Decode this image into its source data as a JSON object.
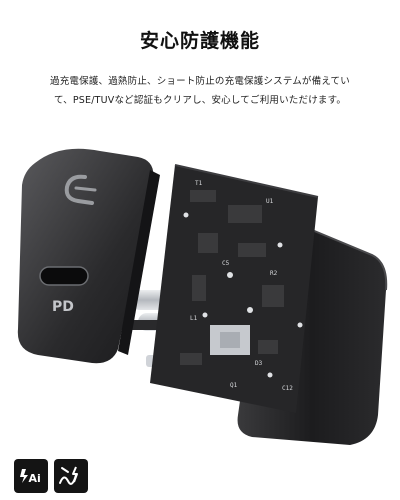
{
  "page": {
    "heading": "安心防護機能",
    "description_line1": "過充電保護、過熱防止、ショート防止の充電保護システムが備えてい",
    "description_line2": "て、PSE/TUVなど認証もクリアし、安心してご利用いただけます。"
  },
  "illustration": {
    "cover_label": "PD",
    "cover_logo": "Lightning-C mark",
    "board_marks": [
      "T1",
      "U1",
      "C5",
      "R2",
      "L1",
      "D3",
      "Q1",
      "C12"
    ]
  },
  "badges": {
    "ai_logo": "Ai",
    "power_logo": "power-wave mark"
  },
  "colors": {
    "background": "#ffffff",
    "text": "#222222",
    "device_body": "#1c1c1e",
    "pcb": "#262628",
    "component": "#3a3a3c",
    "metal": "#c9ccd1"
  }
}
